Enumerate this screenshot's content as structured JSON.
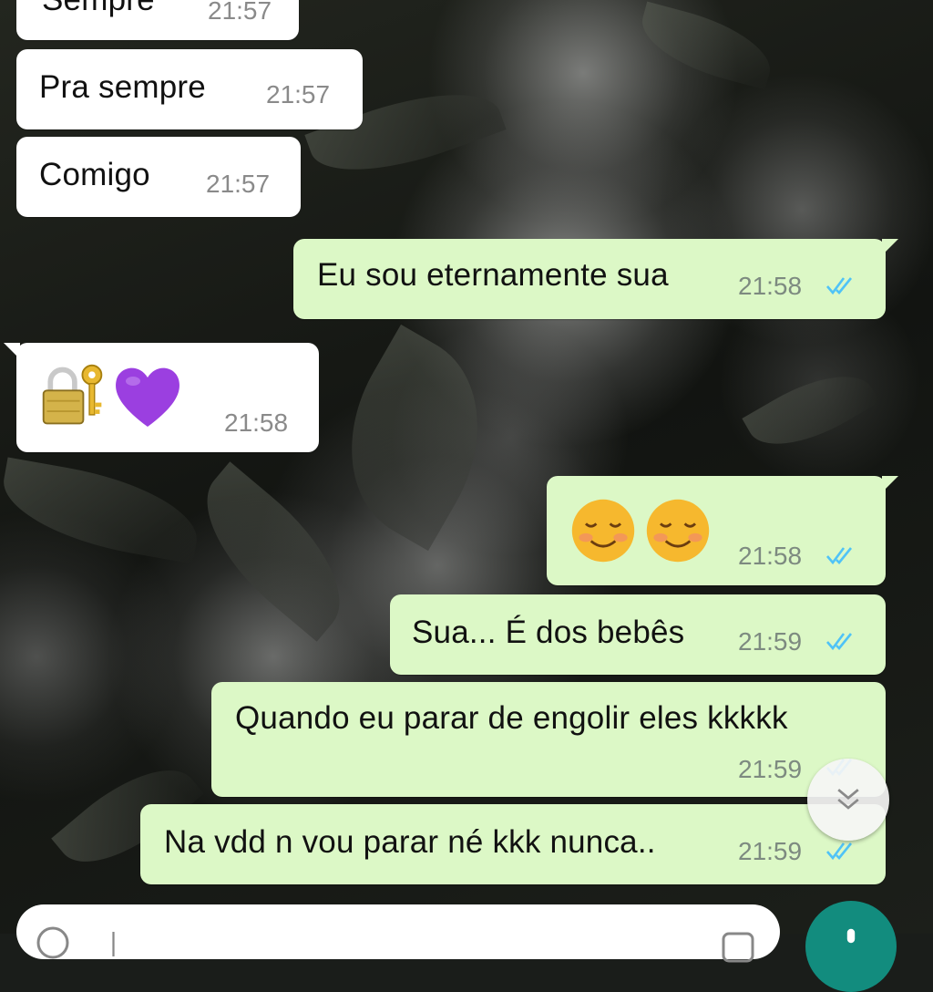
{
  "chat": {
    "messages": [
      {
        "direction": "incoming",
        "text": "Sempre",
        "time": "21:57"
      },
      {
        "direction": "incoming",
        "text": "Pra sempre",
        "time": "21:57"
      },
      {
        "direction": "incoming",
        "text": "Comigo",
        "time": "21:57"
      },
      {
        "direction": "outgoing",
        "text": "Eu sou eternamente sua",
        "time": "21:58",
        "status": "read"
      },
      {
        "direction": "incoming",
        "emojis": [
          "lock-with-key-icon",
          "purple-heart-icon"
        ],
        "time": "21:58"
      },
      {
        "direction": "outgoing",
        "emojis": [
          "smiling-face-icon",
          "smiling-face-icon"
        ],
        "time": "21:58",
        "status": "read"
      },
      {
        "direction": "outgoing",
        "text": "Sua... É dos bebês",
        "time": "21:59",
        "status": "read"
      },
      {
        "direction": "outgoing",
        "text": "Quando eu parar de engolir eles kkkkk",
        "time": "21:59",
        "status": "read"
      },
      {
        "direction": "outgoing",
        "text": "Na vdd n vou parar né kkk nunca..",
        "time": "21:59",
        "status": "read"
      }
    ]
  },
  "colors": {
    "incoming_bubble": "#ffffff",
    "outgoing_bubble": "#dcf8c6",
    "read_ticks": "#4fc3f7",
    "accent": "#128c7e"
  },
  "icons": {
    "read_status": "double-check-icon",
    "scroll_down": "chevron-double-down-icon",
    "send": "mic-icon"
  }
}
